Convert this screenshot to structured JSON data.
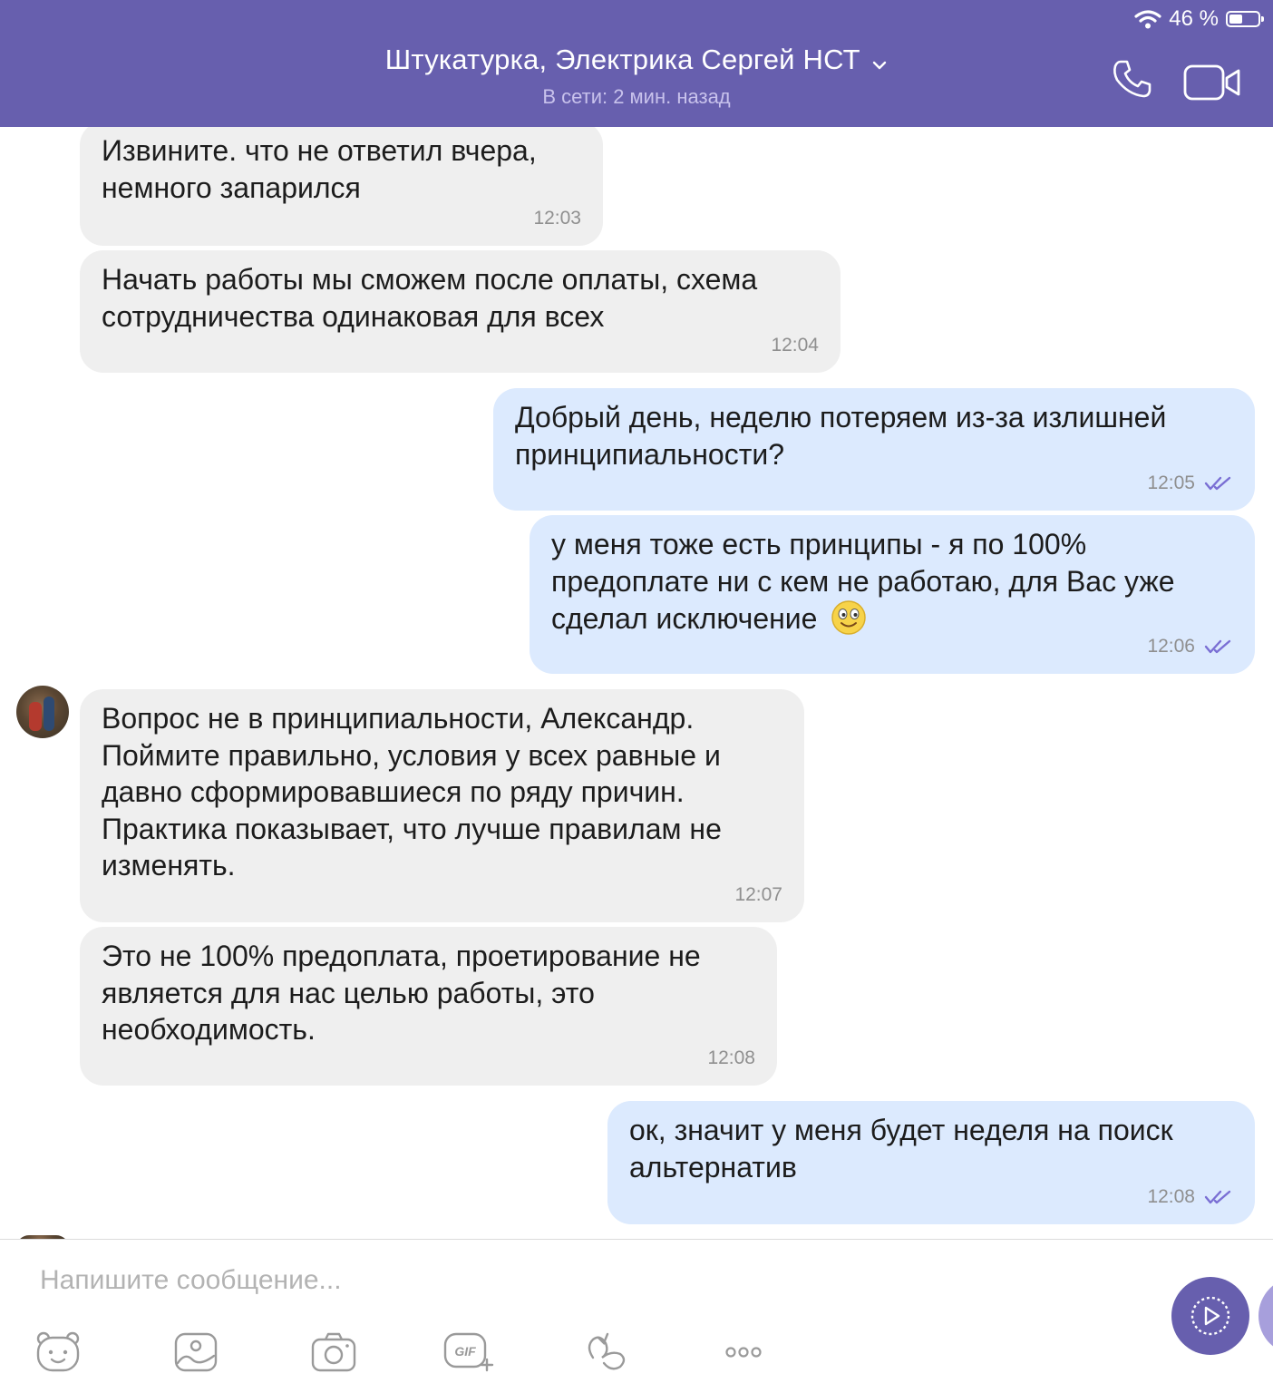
{
  "status_bar": {
    "battery_text": "46 %",
    "battery_level": 0.46
  },
  "header": {
    "title": "Штукатурка, Электрика Сергей НСТ",
    "subtitle": "В сети: 2 мин. назад"
  },
  "messages": [
    {
      "direction": "in",
      "lines": [
        "Извините. что не ответил вчера,",
        "немного запарился"
      ],
      "time": "12:03"
    },
    {
      "direction": "in",
      "lines": [
        "Начать работы мы сможем после оплаты, схема",
        "сотрудничества одинаковая для всех"
      ],
      "time": "12:04"
    },
    {
      "direction": "out",
      "lines": [
        "Добрый день, неделю потеряем из-за излишней",
        "принципиальности?"
      ],
      "time": "12:05"
    },
    {
      "direction": "out",
      "lines": [
        "у меня тоже есть принципы - я по 100%",
        "предоплате ни с кем не работаю, для Вас уже",
        "сделал исключение"
      ],
      "time": "12:06"
    },
    {
      "direction": "in",
      "lines": [
        "Вопрос не в принципиальности, Александр.",
        "Поймите правильно, условия у всех равные и",
        "давно сформировавшиеся по ряду причин.",
        "Практика показывает, что лучше правилам не",
        "изменять."
      ],
      "time": "12:07"
    },
    {
      "direction": "in",
      "lines": [
        "Это не 100% предоплата, проетирование не",
        "является для нас целью работы, это",
        "необходимость."
      ],
      "time": "12:08"
    },
    {
      "direction": "out",
      "lines": [
        "ок, значит у меня будет неделя на поиск",
        "альтернатив"
      ],
      "time": "12:08"
    }
  ],
  "composer": {
    "placeholder": "Напишите сообщение..."
  },
  "toolbar": {
    "icons": [
      "sticker-bear-icon",
      "image-gallery-icon",
      "camera-icon",
      "gif-icon",
      "doodle-icon",
      "more-icon"
    ],
    "gif_label": "GIF"
  },
  "colors": {
    "header_bg": "#675fae",
    "incoming_bubble": "#efefef",
    "outgoing_bubble": "#dceafe",
    "read_tick": "#7a6fd4",
    "send_button": "#675fae"
  }
}
